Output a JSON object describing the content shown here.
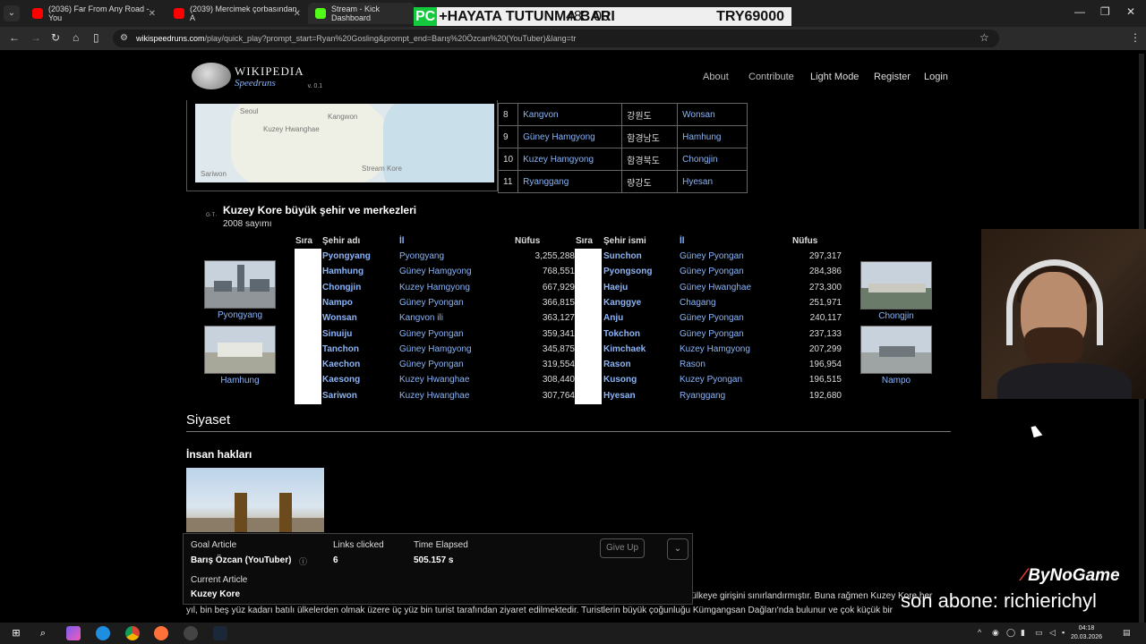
{
  "browser": {
    "tabs": [
      {
        "title": "(2036) Far From Any Road - You",
        "color": "#ff0000",
        "active": false
      },
      {
        "title": "(2039) Mercimek çorbasından A",
        "color": "#ff0000",
        "active": false
      },
      {
        "title": "Stream - Kick Dashboard",
        "color": "#53fc18",
        "active": true
      }
    ],
    "overlay": {
      "pc": "PC",
      "text": "+HAYATA TUTUNMA BARI",
      "val1": "483.00",
      "val2": "TRY69000"
    },
    "url_host": "wikispeedruns.com",
    "url_path": "/play/quick_play?prompt_start=Ryan%20Gosling&prompt_end=Barış%20Özcan%20(YouTuber)&lang=tr"
  },
  "site": {
    "logo_title": "WIKIPEDIA",
    "logo_sub": "Speedruns",
    "version": "v. 0.1",
    "nav": {
      "about": "About",
      "contribute": "Contribute",
      "lightmode": "Light Mode",
      "register": "Register",
      "login": "Login"
    }
  },
  "map_labels": [
    "Kangwon",
    "Kuzey Hwanghae",
    "Stream Kore",
    "Seoul",
    "Sariwon"
  ],
  "provinces": [
    {
      "n": "8",
      "name": "Kangvon",
      "korean": "강원도",
      "capital": "Wonsan"
    },
    {
      "n": "9",
      "name": "Güney Hamgyong",
      "korean": "함경남도",
      "capital": "Hamhung"
    },
    {
      "n": "10",
      "name": "Kuzey Hamgyong",
      "korean": "함경북도",
      "capital": "Chongjin"
    },
    {
      "n": "11",
      "name": "Ryanggang",
      "korean": "량강도",
      "capital": "Hyesan"
    }
  ],
  "cities": {
    "title": "Kuzey Kore büyük şehir ve merkezleri",
    "subtitle": "2008 sayımı",
    "headers_left": {
      "rank": "Sıra",
      "city": "Şehir adı",
      "province": "İl",
      "pop": "Nüfus"
    },
    "headers_right": {
      "rank": "Sıra",
      "city": "Şehir ismi",
      "province": "İl",
      "pop": "Nüfus"
    },
    "left": [
      {
        "city": "Pyongyang",
        "province": "Pyongyang",
        "pop": "3,255,288"
      },
      {
        "city": "Hamhung",
        "province": "Güney Hamgyong",
        "pop": "768,551"
      },
      {
        "city": "Chongjin",
        "province": "Kuzey Hamgyong",
        "pop": "667,929"
      },
      {
        "city": "Nampo",
        "province": "Güney Pyongan",
        "pop": "366,815"
      },
      {
        "city": "Wonsan",
        "province": "Kangvon ili",
        "pop": "363,127"
      },
      {
        "city": "Sinuiju",
        "province": "Güney Pyongan",
        "pop": "359,341"
      },
      {
        "city": "Tanchon",
        "province": "Güney Hamgyong",
        "pop": "345,875"
      },
      {
        "city": "Kaechon",
        "province": "Güney Pyongan",
        "pop": "319,554"
      },
      {
        "city": "Kaesong",
        "province": "Kuzey Hwanghae",
        "pop": "308,440"
      },
      {
        "city": "Sariwon",
        "province": "Kuzey Hwanghae",
        "pop": "307,764"
      }
    ],
    "right": [
      {
        "city": "Sunchon",
        "province": "Güney Pyongan",
        "pop": "297,317"
      },
      {
        "city": "Pyongsong",
        "province": "Güney Pyongan",
        "pop": "284,386"
      },
      {
        "city": "Haeju",
        "province": "Güney Hwanghae",
        "pop": "273,300"
      },
      {
        "city": "Kanggye",
        "province": "Chagang",
        "pop": "251,971"
      },
      {
        "city": "Anju",
        "province": "Güney Pyongan",
        "pop": "240,117"
      },
      {
        "city": "Tokchon",
        "province": "Güney Pyongan",
        "pop": "237,133"
      },
      {
        "city": "Kimchaek",
        "province": "Kuzey Hamgyong",
        "pop": "207,299"
      },
      {
        "city": "Rason",
        "province": "Rason",
        "pop": "196,954"
      },
      {
        "city": "Kusong",
        "province": "Kuzey Pyongan",
        "pop": "196,515"
      },
      {
        "city": "Hyesan",
        "province": "Ryanggang",
        "pop": "192,680"
      }
    ],
    "thumbs": {
      "left_top": "Pyongyang",
      "left_bottom": "Hamhung",
      "right_top": "Chongjin",
      "right_bottom": "Nampo"
    }
  },
  "sections": {
    "siyaset": "Siyaset",
    "insan": "İnsan hakları"
  },
  "paragraph": {
    "line1": "n ülkeye girişini sınırlandırmıştır. Buna rağmen Kuzey Kore her",
    "line2": "yıl, bin beş yüz kadarı batılı ülkelerden olmak üzere üç yüz bin turist tarafından ziyaret edilmektedir. Turistlerin büyük çoğunluğu Kümgangsan Dağları'nda bulunur ve çok küçük bir"
  },
  "speedrun": {
    "goal_label": "Goal Article",
    "goal_value": "Barış Özcan (YouTuber)",
    "links_label": "Links clicked",
    "links_value": "6",
    "time_label": "Time Elapsed",
    "time_value": "505.157 s",
    "current_label": "Current Article",
    "current_value": "Kuzey Kore",
    "give_up": "Give Up"
  },
  "stream": {
    "brand": "ByNoGame",
    "abone": "son abone: richierichyl"
  },
  "taskbar": {
    "time": "04:18",
    "date": "20.03.2026"
  },
  "colors": {
    "link": "#8ab4f8",
    "bg": "#000000",
    "kick": "#53fc18"
  }
}
